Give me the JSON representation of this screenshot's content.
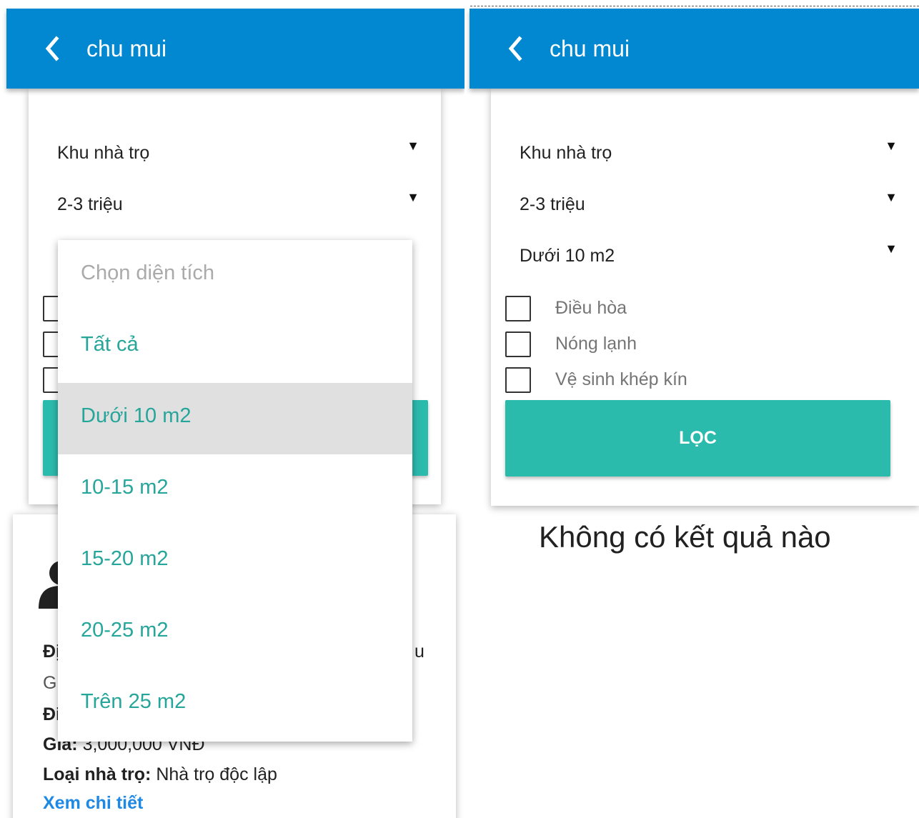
{
  "left": {
    "appbar": {
      "title": "chu mui"
    },
    "filter": {
      "area_type": "Khu nhà trọ",
      "price": "2-3 triệu"
    },
    "result": {
      "lines": [
        {
          "label": "Đị",
          "value": ""
        },
        {
          "label": "",
          "value": "Gi"
        },
        {
          "label": "Đi",
          "value": ""
        },
        {
          "label": "Giá:",
          "value": " 3,000,000 VNĐ"
        },
        {
          "label": "Loại nhà trọ:",
          "value": " Nhà trọ độc lập"
        }
      ],
      "address_tail": "u",
      "detail_link": "Xem chi tiết"
    },
    "dropdown": {
      "placeholder": "Chọn diện tích",
      "options": [
        "Tất cả",
        "Dưới 10 m2",
        "10-15 m2",
        "15-20 m2",
        "20-25 m2",
        "Trên 25 m2"
      ],
      "selected": "Dưới 10 m2"
    }
  },
  "right": {
    "appbar": {
      "title": "chu mui"
    },
    "filter": {
      "area_type": "Khu nhà trọ",
      "price": "2-3 triệu",
      "size": "Dưới 10 m2",
      "checkboxes": [
        "Điều hòa",
        "Nóng lạnh",
        "Vệ sinh khép kín"
      ],
      "button": "LỌC"
    },
    "empty_message": "Không có kết quả nào"
  },
  "icons": {
    "back": "chevron-left-icon",
    "dropdown_arrow": "caret-down-icon",
    "avatar": "person-icon"
  },
  "colors": {
    "appbar": "#0288d1",
    "accent": "#2bbbad",
    "option_text": "#26a69a",
    "link": "#1e88e5",
    "selected_bg": "#e0e0e0"
  }
}
